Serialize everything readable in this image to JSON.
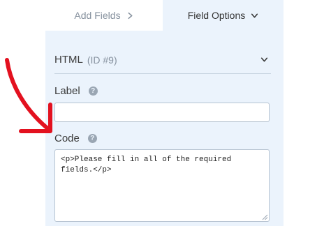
{
  "tabs": {
    "add_fields": "Add Fields",
    "field_options": "Field Options"
  },
  "section": {
    "title": "HTML",
    "id_label": "(ID #9)"
  },
  "label_field": {
    "label": "Label",
    "value": ""
  },
  "code_field": {
    "label": "Code",
    "value": "<p>Please fill in all of the required fields.</p>"
  },
  "help_glyph": "?",
  "colors": {
    "panel_bg": "#ebf3fc",
    "annotation_arrow": "#e3111f",
    "muted_text": "#86919e"
  },
  "icons": {
    "add_fields_chevron": "chevron-right-icon",
    "field_options_chevron": "chevron-down-icon",
    "collapse": "chevron-down-icon",
    "help": "help-circle-icon",
    "annotation": "red-arrow-annotation"
  }
}
